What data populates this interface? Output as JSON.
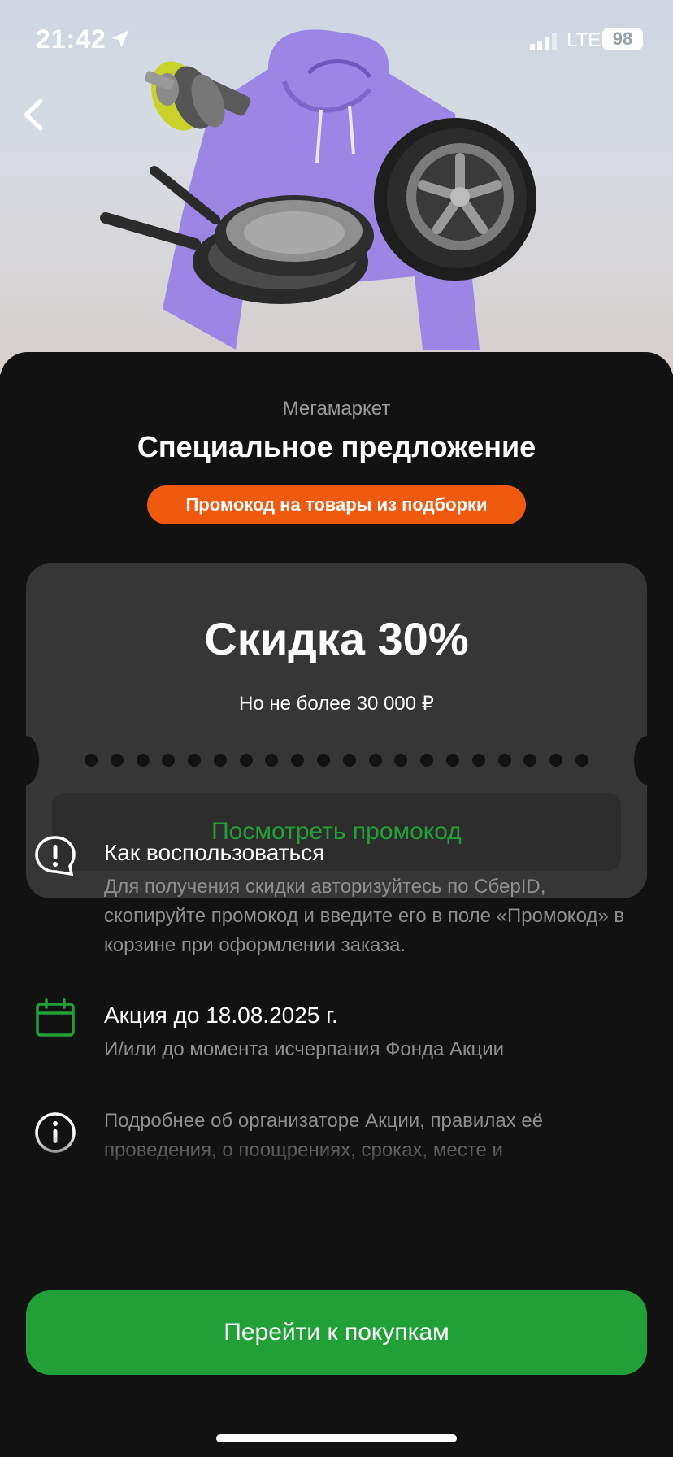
{
  "status": {
    "time": "21:42",
    "network": "LTE",
    "battery": "98"
  },
  "header": {
    "back_icon": "chevron-left-icon"
  },
  "offer": {
    "brand": "Мегамаркет",
    "title": "Специальное предложение",
    "badge": "Промокод на товары из подборки"
  },
  "coupon": {
    "discount": "Скидка 30%",
    "limit": "Но не более 30 000 ₽",
    "show_code_label": "Посмотреть промокод"
  },
  "info": [
    {
      "icon": "exclamation-bubble-icon",
      "heading": "Как воспользоваться",
      "text": "Для получения скидки авторизуйтесь по СберID, скопируйте промокод и введите его в поле «Промокод» в корзине при оформлении заказа."
    },
    {
      "icon": "calendar-icon",
      "heading": "Акция до 18.08.2025 г.",
      "text": "И/или до момента исчерпания Фонда Акции"
    },
    {
      "icon": "info-circle-icon",
      "text": "Подробнее об организаторе Акции, правилах её проведения, о поощрениях, сроках, месте и"
    }
  ],
  "cta": {
    "label": "Перейти к покупкам"
  },
  "colors": {
    "accent_green": "#21a038",
    "badge_orange": "#f05a0e",
    "background": "#121212",
    "card": "#363636"
  }
}
